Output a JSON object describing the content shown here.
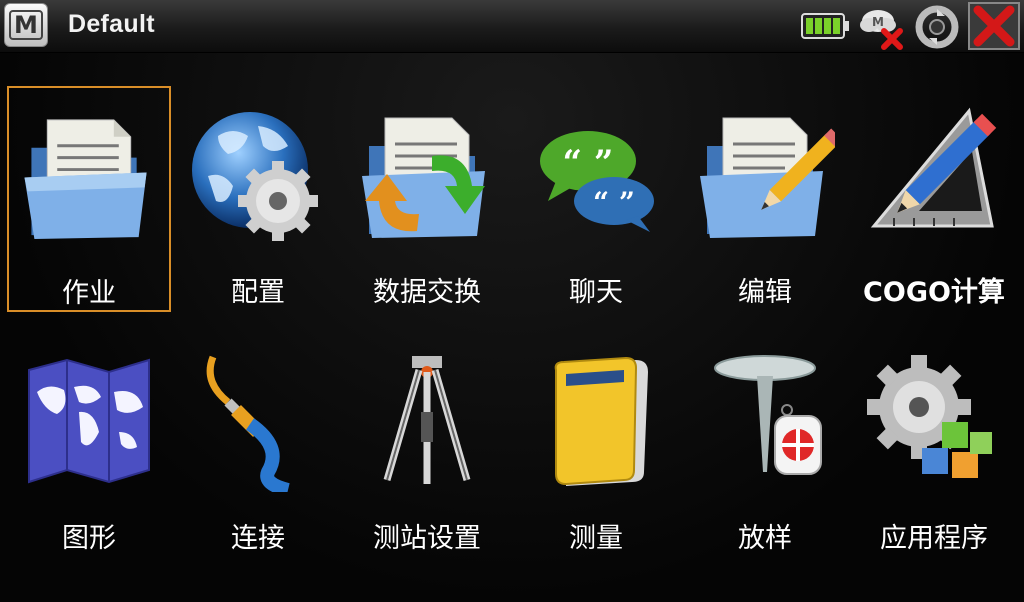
{
  "titlebar": {
    "menu_glyph": "M",
    "title": "Default",
    "status_icons": [
      "battery-icon",
      "network-disconnected-icon",
      "sync-icon",
      "close-icon"
    ]
  },
  "menu": {
    "items": [
      {
        "label": "作业",
        "icon": "folder-documents-icon",
        "selected": true
      },
      {
        "label": "配置",
        "icon": "globe-gear-icon",
        "selected": false
      },
      {
        "label": "数据交换",
        "icon": "folder-exchange-arrows-icon",
        "selected": false
      },
      {
        "label": "聊天",
        "icon": "chat-bubbles-icon",
        "selected": false
      },
      {
        "label": "编辑",
        "icon": "folder-pencil-icon",
        "selected": false
      },
      {
        "label": "COGO计算",
        "icon": "pencil-set-square-icon",
        "selected": false
      },
      {
        "label": "图形",
        "icon": "world-map-icon",
        "selected": false
      },
      {
        "label": "连接",
        "icon": "cable-plug-icon",
        "selected": false
      },
      {
        "label": "测站设置",
        "icon": "tripod-icon",
        "selected": false
      },
      {
        "label": "测量",
        "icon": "yellow-book-icon",
        "selected": false
      },
      {
        "label": "放样",
        "icon": "survey-nail-target-icon",
        "selected": false
      },
      {
        "label": "应用程序",
        "icon": "gear-blocks-icon",
        "selected": false
      }
    ]
  },
  "colors": {
    "selection_border": "#d98e28",
    "background": "#0a0a0a",
    "titlebar": "#2a2a2a"
  }
}
